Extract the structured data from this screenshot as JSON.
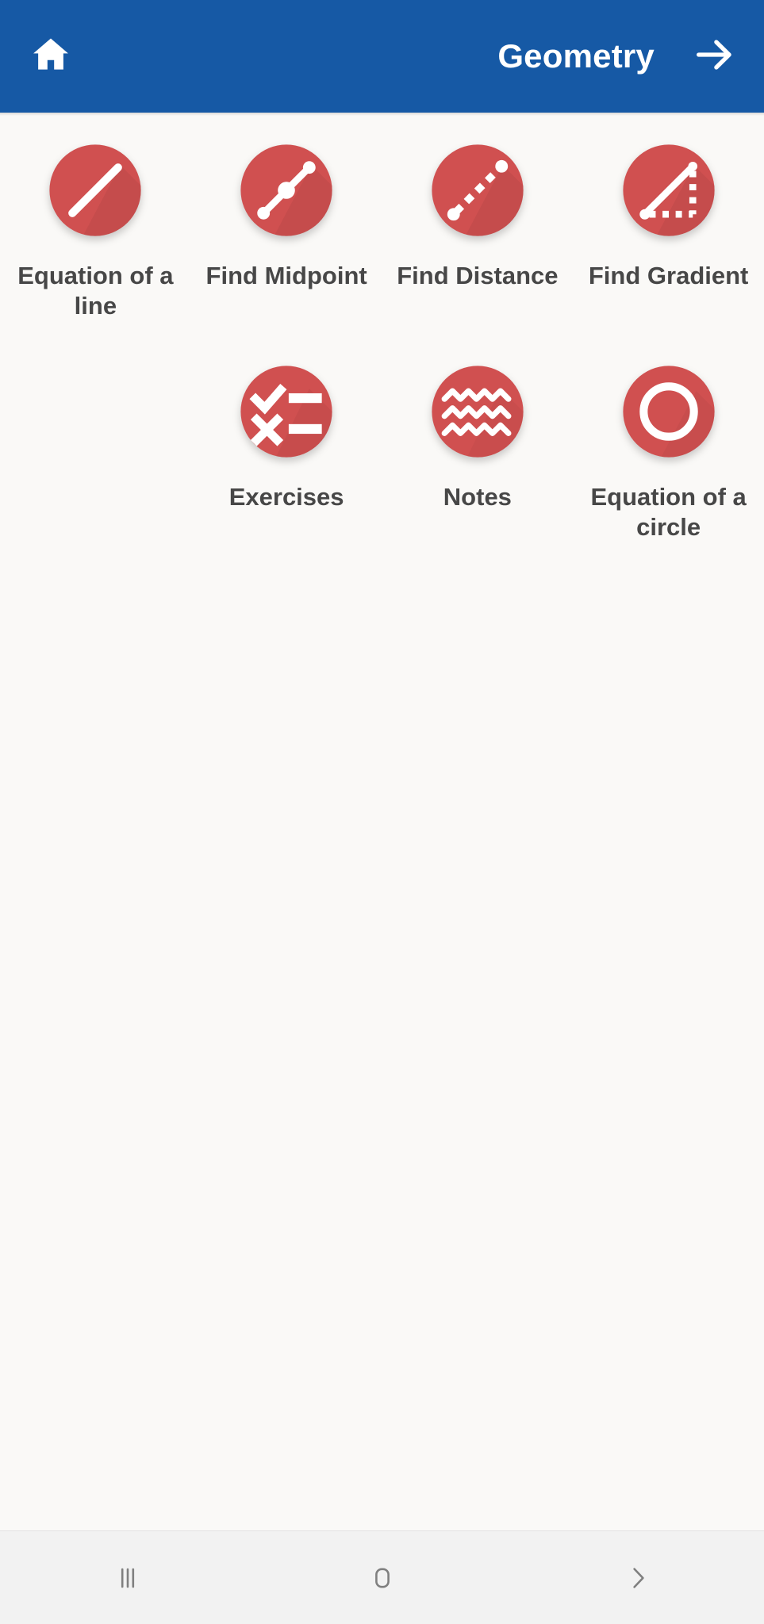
{
  "appbar": {
    "home_icon": "home-icon",
    "title": "Geometry",
    "next_icon": "arrow-right-icon",
    "background_color": "#1659A5",
    "text_color": "#FFFFFF"
  },
  "theme": {
    "page_background": "#FAF9F7",
    "tile_icon_color": "#D05050",
    "tile_icon_shade_color": "#BC4848",
    "tile_glyph_color": "#FFFFFF",
    "label_color": "#474747",
    "navbar_background": "#F2F2F2",
    "navbar_glyph_color": "#808080"
  },
  "grid": {
    "columns": 4,
    "tiles": [
      {
        "label": "Equation of a line",
        "icon": "diagonal-line-icon",
        "position": 1
      },
      {
        "label": "Find Midpoint",
        "icon": "line-with-midpoint-icon",
        "position": 2
      },
      {
        "label": "Find Distance",
        "icon": "dashed-line-icon",
        "position": 3
      },
      {
        "label": "Find Gradient",
        "icon": "gradient-triangle-icon",
        "position": 4
      },
      {
        "label": "Exercises",
        "icon": "checklist-icon",
        "position": 6
      },
      {
        "label": "Notes",
        "icon": "zigzag-lines-icon",
        "position": 7
      },
      {
        "label": "Equation of a circle",
        "icon": "circle-outline-icon",
        "position": 8
      }
    ]
  },
  "navbar": {
    "recents_label": "recent-apps-icon",
    "home_label": "home-square-icon",
    "back_label": "back-chevron-icon"
  }
}
